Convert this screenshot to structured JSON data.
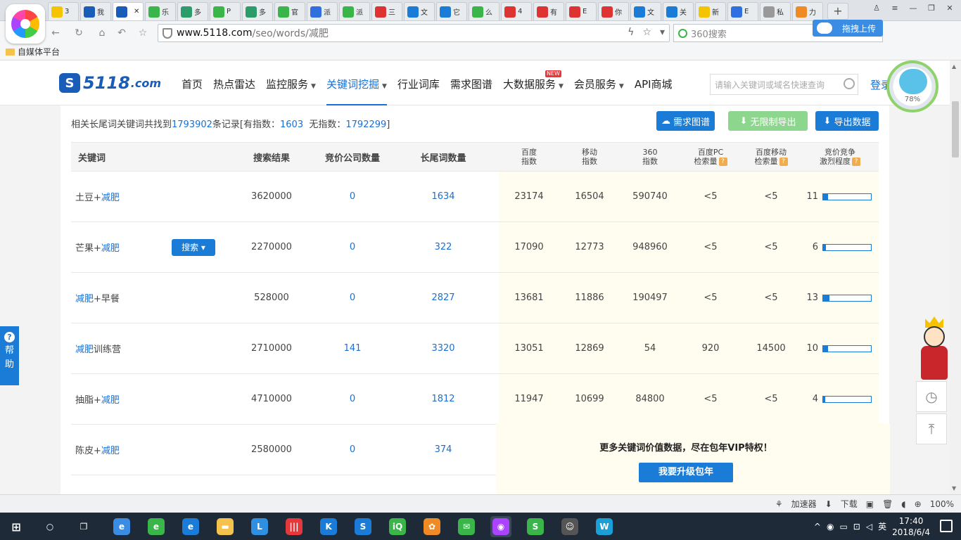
{
  "browser": {
    "tabs": [
      {
        "label": "3",
        "color": "#f4c400"
      },
      {
        "label": "我",
        "color": "#1a5db8"
      },
      {
        "label": "",
        "color": "#1a5db8",
        "active": true
      },
      {
        "label": "乐",
        "color": "#39b54a"
      },
      {
        "label": "多",
        "color": "#2c9c6a"
      },
      {
        "label": "P",
        "color": "#39b54a"
      },
      {
        "label": "多",
        "color": "#2c9c6a"
      },
      {
        "label": "官",
        "color": "#39b54a"
      },
      {
        "label": "派",
        "color": "#2f6fe0"
      },
      {
        "label": "派",
        "color": "#39b54a"
      },
      {
        "label": "三",
        "color": "#d33"
      },
      {
        "label": "文",
        "color": "#1a7cd6"
      },
      {
        "label": "它",
        "color": "#1a7cd6"
      },
      {
        "label": "么",
        "color": "#39b54a"
      },
      {
        "label": "4",
        "color": "#d33"
      },
      {
        "label": "有",
        "color": "#d33"
      },
      {
        "label": "E",
        "color": "#d33"
      },
      {
        "label": "你",
        "color": "#d33"
      },
      {
        "label": "文",
        "color": "#1a7cd6"
      },
      {
        "label": "关",
        "color": "#1a7cd6"
      },
      {
        "label": "新",
        "color": "#f4c400"
      },
      {
        "label": "E",
        "color": "#2f6fe0"
      },
      {
        "label": "私",
        "color": "#999"
      },
      {
        "label": "力",
        "color": "#f08a24"
      }
    ],
    "new_tab": "+",
    "url_host": "www.5118.com",
    "url_path": "/seo/words/减肥",
    "search_placeholder": "360搜索",
    "upload_label": "拖拽上传",
    "bookmark": "自媒体平台",
    "nav_icons": [
      "←",
      "↻",
      "⌂",
      "↶",
      "☆"
    ]
  },
  "site": {
    "logo_big": "5118",
    "logo_small": ".com",
    "nav": [
      {
        "label": "首页"
      },
      {
        "label": "热点雷达"
      },
      {
        "label": "监控服务",
        "dropdown": true
      },
      {
        "label": "关键词挖掘",
        "dropdown": true,
        "active": true
      },
      {
        "label": "行业词库"
      },
      {
        "label": "需求图谱"
      },
      {
        "label": "大数据服务",
        "dropdown": true,
        "badge": "NEW"
      },
      {
        "label": "会员服务",
        "dropdown": true
      },
      {
        "label": "API商城"
      }
    ],
    "search_placeholder": "请输入关键词或域名快速查询",
    "login": "登录",
    "speed_pct": "78%"
  },
  "summary": {
    "prefix": "相关长尾词关键词共找到",
    "total": "1793902",
    "mid": "条记录[有指数：",
    "with_index": "1603",
    "mid2": "无指数：",
    "without_index": "1792299",
    "suffix": "]"
  },
  "buttons": {
    "graph": "需求图谱",
    "export": "无限制导出",
    "export_data": "导出数据",
    "row_search": "搜索"
  },
  "table": {
    "headers": {
      "keyword": "关键词",
      "results": "搜索结果",
      "bid": "竞价公司数量",
      "longtail": "长尾词数量",
      "baidu1": "百度",
      "baidu2": "指数",
      "mobile1": "移动",
      "mobile2": "指数",
      "s3601": "360",
      "s3602": "指数",
      "pc1": "百度PC",
      "pc2": "检索量",
      "mob1": "百度移动",
      "mob2": "检索量",
      "comp1": "竞价竞争",
      "comp2": "激烈程度"
    },
    "rows": [
      {
        "kw_a": "土豆+",
        "kw_b": "减肥",
        "kw_c": "",
        "results": "3620000",
        "bid": "0",
        "longtail": "1634",
        "baidu": "23174",
        "mobile": "16504",
        "s360": "590740",
        "pc": "<5",
        "mob": "<5",
        "comp": "11"
      },
      {
        "kw_a": "芒果+",
        "kw_b": "减肥",
        "kw_c": "",
        "results": "2270000",
        "bid": "0",
        "longtail": "322",
        "baidu": "17090",
        "mobile": "12773",
        "s360": "948960",
        "pc": "<5",
        "mob": "<5",
        "comp": "6"
      },
      {
        "kw_a": "",
        "kw_b": "减肥",
        "kw_c": "+早餐",
        "results": "528000",
        "bid": "0",
        "longtail": "2827",
        "baidu": "13681",
        "mobile": "11886",
        "s360": "190497",
        "pc": "<5",
        "mob": "<5",
        "comp": "13"
      },
      {
        "kw_a": "",
        "kw_b": "减肥",
        "kw_c": "训练营",
        "results": "2710000",
        "bid": "141",
        "longtail": "3320",
        "baidu": "13051",
        "mobile": "12869",
        "s360": "54",
        "pc": "920",
        "mob": "14500",
        "comp": "10"
      },
      {
        "kw_a": "抽脂+",
        "kw_b": "减肥",
        "kw_c": "",
        "results": "4710000",
        "bid": "0",
        "longtail": "1812",
        "baidu": "11947",
        "mobile": "10699",
        "s360": "84800",
        "pc": "<5",
        "mob": "<5",
        "comp": "4"
      },
      {
        "kw_a": "陈皮+",
        "kw_b": "减肥",
        "kw_c": "",
        "results": "2580000",
        "bid": "0",
        "longtail": "374"
      }
    ]
  },
  "vip": {
    "message": "更多关键词价值数据，尽在包年VIP特权！",
    "upgrade": "我要升级包年"
  },
  "help": "帮助",
  "statusbar": {
    "accelerator": "加速器",
    "download": "下载",
    "zoom": "100%"
  },
  "taskbar": {
    "apps": [
      {
        "glyph": "e",
        "color": "#3b8ce3"
      },
      {
        "glyph": "e",
        "color": "#39b54a"
      },
      {
        "glyph": "e",
        "color": "#1a7cd6"
      },
      {
        "glyph": "▬",
        "color": "#f4c24d"
      },
      {
        "glyph": "L",
        "color": "#2f8fe0"
      },
      {
        "glyph": "|||",
        "color": "#e4393c"
      },
      {
        "glyph": "K",
        "color": "#1a7cd6"
      },
      {
        "glyph": "S",
        "color": "#1a7cd6"
      },
      {
        "glyph": "iQ",
        "color": "#39b54a"
      },
      {
        "glyph": "✿",
        "color": "#f08a24"
      },
      {
        "glyph": "✉",
        "color": "#39b54a"
      },
      {
        "glyph": "◉",
        "color": "#a4f"
      },
      {
        "glyph": "S",
        "color": "#39b54a"
      },
      {
        "glyph": "☺",
        "color": "#555"
      },
      {
        "glyph": "W",
        "color": "#1a9fd6"
      }
    ],
    "ime": "英",
    "time": "17:40",
    "date": "2018/6/4"
  }
}
